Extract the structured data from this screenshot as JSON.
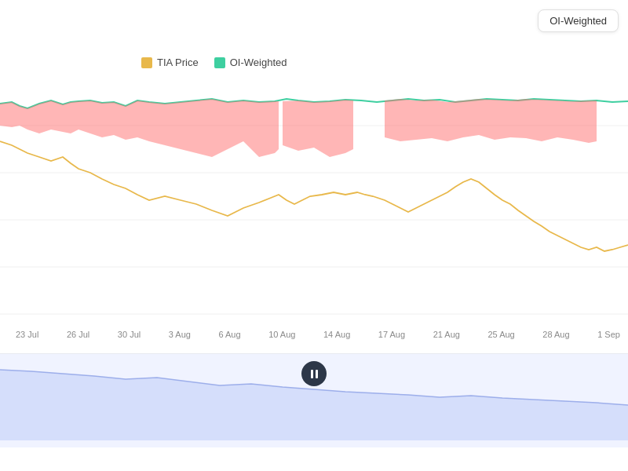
{
  "header": {
    "oi_button_label": "OI-Weighted"
  },
  "legend": {
    "tia_label": "TIA Price",
    "oi_label": "OI-Weighted",
    "tia_color": "#e8b84b",
    "oi_color": "#3ecfa0"
  },
  "xaxis": {
    "labels": [
      "23 Jul",
      "26 Jul",
      "30 Jul",
      "3 Aug",
      "6 Aug",
      "10 Aug",
      "14 Aug",
      "17 Aug",
      "21 Aug",
      "25 Aug",
      "28 Aug",
      "1 Sep"
    ]
  },
  "chart": {
    "background": "#ffffff",
    "red_fill_color": "rgba(255, 120, 120, 0.55)",
    "tia_line_color": "#e8b84b",
    "oi_line_color": "#3ecfa0",
    "mini_fill_color": "rgba(180, 195, 240, 0.5)"
  }
}
